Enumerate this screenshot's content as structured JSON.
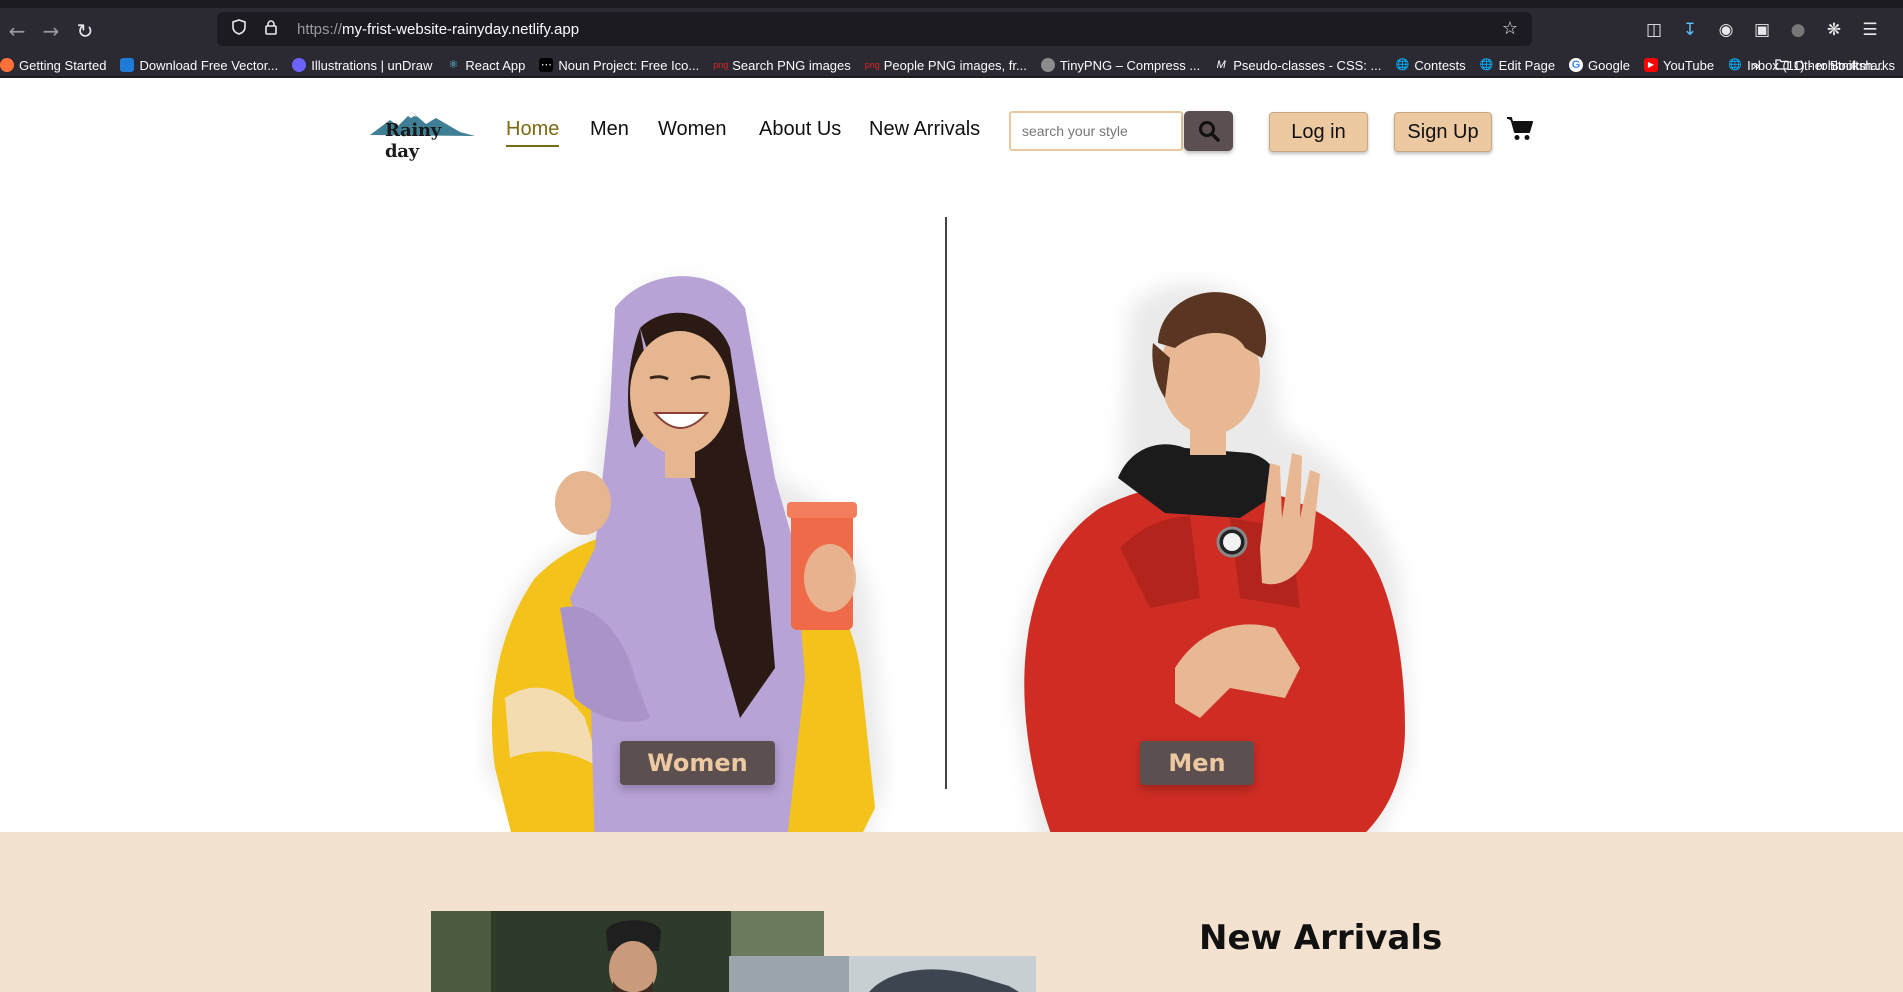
{
  "browser": {
    "url_scheme": "https://",
    "url_host": "my-frist-website-rainyday.netlify.app",
    "bookmarks": [
      {
        "label": "Getting Started",
        "color": "#ff7139"
      },
      {
        "label": "Download Free Vector...",
        "color": "#1f7bd8"
      },
      {
        "label": "Illustrations | unDraw",
        "color": "#6c63ff"
      },
      {
        "label": "React App",
        "color": "#61dafb"
      },
      {
        "label": "Noun Project: Free Ico...",
        "color": "#000000"
      },
      {
        "label": "Search PNG images",
        "color": "#e02424"
      },
      {
        "label": "People PNG images, fr...",
        "color": "#e02424"
      },
      {
        "label": "TinyPNG – Compress ...",
        "color": "#8c8c8c"
      },
      {
        "label": "Pseudo-classes - CSS: ...",
        "color": "#222222"
      },
      {
        "label": "Contests",
        "color": "#8c8c8c"
      },
      {
        "label": "Edit Page",
        "color": "#8c8c8c"
      },
      {
        "label": "Google",
        "color": "#4285f4"
      },
      {
        "label": "YouTube",
        "color": "#ff0000"
      },
      {
        "label": "Inbox (11) - rohitniftsh...",
        "color": "#8c8c8c"
      }
    ],
    "other_bookmarks": "Other Bookmarks"
  },
  "site": {
    "logo_text": "Rainy day",
    "nav": [
      "Home",
      "Men",
      "Women",
      "About Us",
      "New Arrivals"
    ],
    "active_nav": "Home",
    "search_placeholder": "search your style",
    "login_label": "Log in",
    "signup_label": "Sign Up",
    "colors": {
      "accent": "#edc9a2",
      "dark_button": "#5b4f4f",
      "active_link": "#7a6a14",
      "band": "#f3e2d0"
    }
  },
  "hero": {
    "women_label": "Women",
    "men_label": "Men"
  },
  "new_arrivals": {
    "title": "New Arrivals"
  }
}
